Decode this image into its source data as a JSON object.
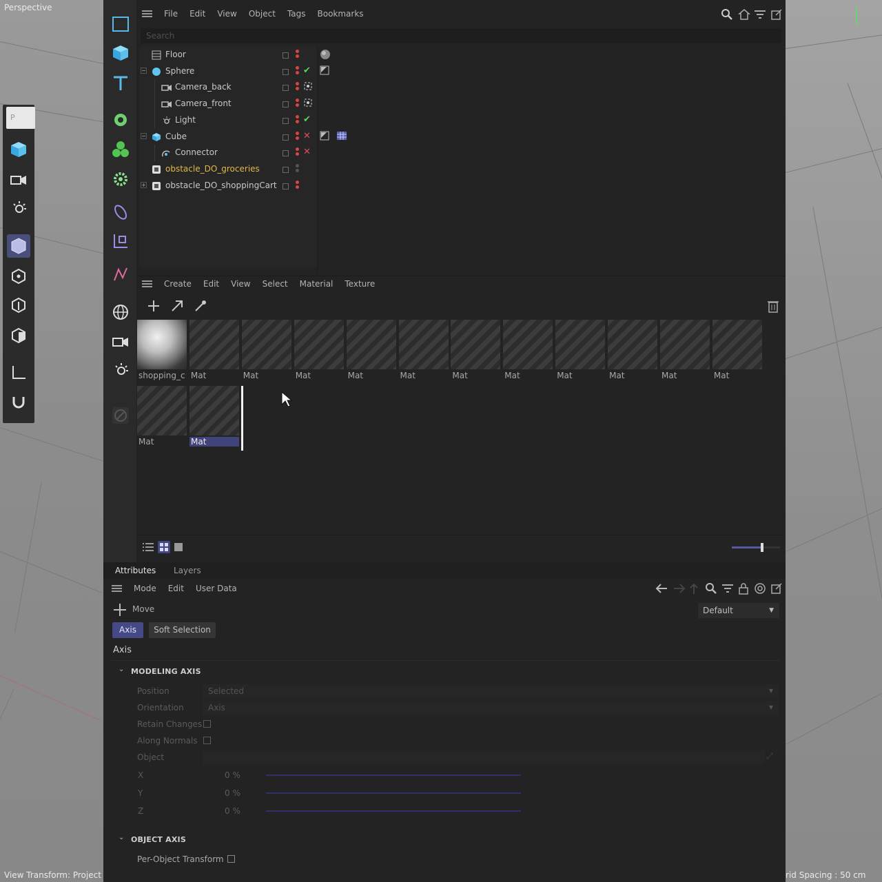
{
  "viewport": {
    "label": "Perspective",
    "status_left": "View Transform: Project",
    "status_right": "rid Spacing : 50 cm",
    "palette_top_label": "P"
  },
  "object_manager": {
    "menu": [
      "File",
      "Edit",
      "View",
      "Object",
      "Tags",
      "Bookmarks"
    ],
    "search_placeholder": "Search",
    "objects": [
      {
        "name": "Floor",
        "icon": "floor-icon",
        "indent": 0,
        "expand": "",
        "highlight": false,
        "tags": [
          "material-sphere-tag-icon"
        ]
      },
      {
        "name": "Sphere",
        "icon": "sphere-icon",
        "indent": 0,
        "expand": "minus",
        "highlight": false,
        "tags": [
          "check-icon",
          "flag-tag-icon"
        ]
      },
      {
        "name": "Camera_back",
        "icon": "camera-icon",
        "indent": 1,
        "expand": "",
        "highlight": false,
        "tags": [
          "target-tag-icon"
        ]
      },
      {
        "name": "Camera_front",
        "icon": "camera-icon",
        "indent": 1,
        "expand": "",
        "highlight": false,
        "tags": [
          "target-tag-icon"
        ]
      },
      {
        "name": "Light",
        "icon": "light-icon",
        "indent": 1,
        "expand": "",
        "highlight": false,
        "tags": [
          "check-icon"
        ]
      },
      {
        "name": "Cube",
        "icon": "cube-icon",
        "indent": 0,
        "expand": "minus",
        "highlight": false,
        "tags": [
          "x-icon",
          "flag-tag-icon",
          "grid-tag-icon"
        ]
      },
      {
        "name": "Connector",
        "icon": "connector-icon",
        "indent": 1,
        "expand": "",
        "highlight": false,
        "tags": [
          "x-icon"
        ]
      },
      {
        "name": "obstacle_DO_groceries",
        "icon": "null-icon",
        "indent": 0,
        "expand": "",
        "highlight": true,
        "tags": []
      },
      {
        "name": "obstacle_DO_shoppingCart",
        "icon": "null-icon",
        "indent": 0,
        "expand": "plus",
        "highlight": false,
        "tags": []
      }
    ]
  },
  "material_manager": {
    "menu": [
      "Create",
      "Edit",
      "View",
      "Select",
      "Material",
      "Texture"
    ],
    "row1": [
      "shopping_c",
      "Mat",
      "Mat",
      "Mat",
      "Mat",
      "Mat",
      "Mat",
      "Mat",
      "Mat",
      "Mat",
      "Mat",
      "Mat"
    ],
    "row2": [
      "Mat",
      "Mat"
    ]
  },
  "attributes": {
    "tabs": [
      "Attributes",
      "Layers"
    ],
    "menu": [
      "Mode",
      "Edit",
      "User Data"
    ],
    "tool_name": "Move",
    "preset": "Default",
    "subtabs": [
      "Axis",
      "Soft Selection"
    ],
    "group_title": "Axis",
    "modeling_axis": {
      "title": "MODELING AXIS",
      "position_label": "Position",
      "position_value": "Selected",
      "orientation_label": "Orientation",
      "orientation_value": "Axis",
      "retain_label": "Retain Changes",
      "normals_label": "Along Normals",
      "object_label": "Object",
      "x_label": "X",
      "x_value": "0 %",
      "y_label": "Y",
      "y_value": "0 %",
      "z_label": "Z",
      "z_value": "0 %"
    },
    "object_axis": {
      "title": "OBJECT AXIS",
      "per_object_label": "Per-Object Transform"
    }
  },
  "colors": {
    "accent": "#454a86",
    "highlight_text": "#e3b84a",
    "check": "#5bd65b",
    "cross": "#e05050",
    "tool_icon": "#6ec6ef"
  }
}
